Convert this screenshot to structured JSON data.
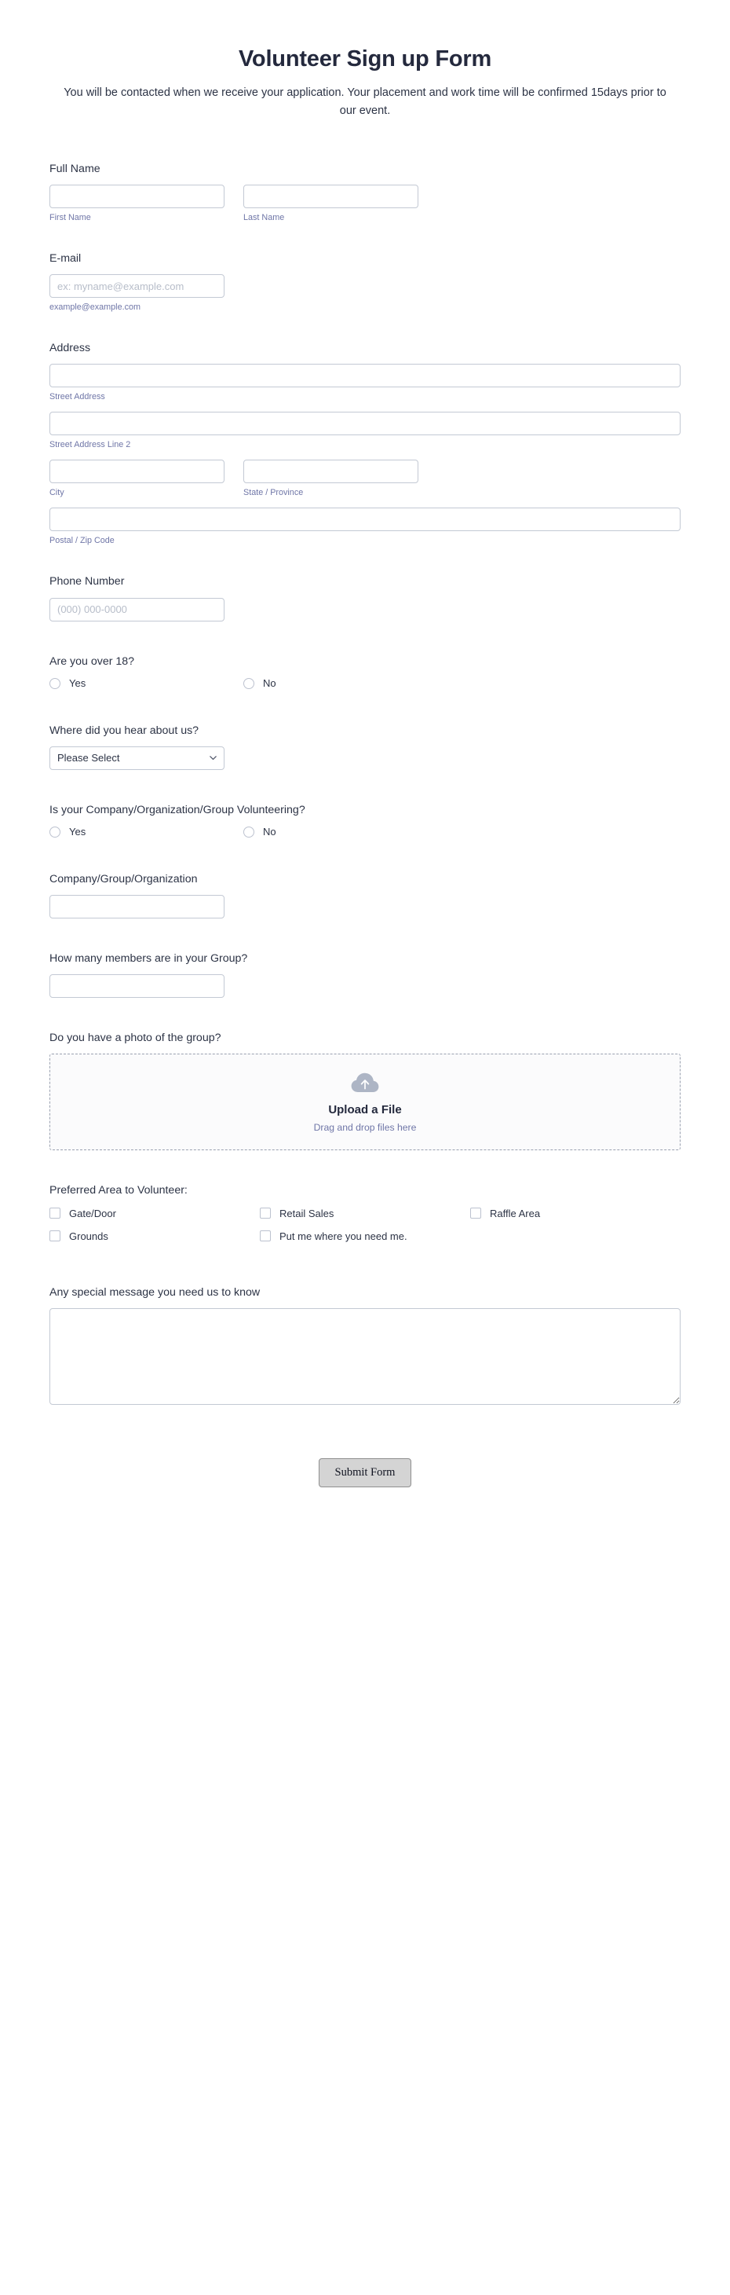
{
  "header": {
    "title": "Volunteer Sign up Form",
    "subtitle": "You will be contacted when we receive your application. Your placement and work time will be confirmed 15days prior to our event."
  },
  "fields": {
    "full_name": {
      "label": "Full Name",
      "first": {
        "value": "",
        "placeholder": "",
        "sub_label": "First Name"
      },
      "last": {
        "value": "",
        "placeholder": "",
        "sub_label": "Last Name"
      }
    },
    "email": {
      "label": "E-mail",
      "value": "",
      "placeholder": "ex: myname@example.com",
      "sub_label": "example@example.com"
    },
    "address": {
      "label": "Address",
      "street": {
        "value": "",
        "sub_label": "Street Address"
      },
      "street2": {
        "value": "",
        "sub_label": "Street Address Line 2"
      },
      "city": {
        "value": "",
        "sub_label": "City"
      },
      "state": {
        "value": "",
        "sub_label": "State / Province"
      },
      "postal": {
        "value": "",
        "sub_label": "Postal / Zip Code"
      }
    },
    "phone": {
      "label": "Phone Number",
      "value": "",
      "placeholder": "(000) 000-0000"
    },
    "over18": {
      "label": "Are you over 18?",
      "options": [
        {
          "label": "Yes",
          "selected": false
        },
        {
          "label": "No",
          "selected": false
        }
      ]
    },
    "hear_about": {
      "label": "Where did you hear about us?",
      "selected": "Please Select",
      "options": [
        "Please Select"
      ],
      "icon": "chevron-down-icon"
    },
    "group_volunteering": {
      "label": "Is your Company/Organization/Group Volunteering?",
      "options": [
        {
          "label": "Yes",
          "selected": false
        },
        {
          "label": "No",
          "selected": false
        }
      ]
    },
    "organization": {
      "label": "Company/Group/Organization",
      "value": ""
    },
    "members_count": {
      "label": "How many members are in your Group?",
      "value": ""
    },
    "group_photo": {
      "label": "Do you have a photo of the group?",
      "upload_icon": "cloud-upload-icon",
      "upload_title": "Upload a File",
      "upload_hint": "Drag and drop files here"
    },
    "preferred_area": {
      "label": "Preferred Area to Volunteer:",
      "options": [
        {
          "label": "Gate/Door",
          "checked": false
        },
        {
          "label": "Retail Sales",
          "checked": false
        },
        {
          "label": "Raffle Area",
          "checked": false
        },
        {
          "label": "Grounds",
          "checked": false
        },
        {
          "label": "Put me where you need me.",
          "checked": false
        }
      ]
    },
    "special_message": {
      "label": "Any special message you need us to know",
      "value": "",
      "placeholder": ""
    }
  },
  "submit": {
    "label": "Submit Form"
  },
  "colors": {
    "text": "#2c3345",
    "heading": "#24293d",
    "sub_label": "#6f76a7",
    "border": "#c3c9d4",
    "placeholder": "#b7bdc9",
    "upload_icon": "#adb5c5",
    "button_bg": "#d4d4d4"
  }
}
